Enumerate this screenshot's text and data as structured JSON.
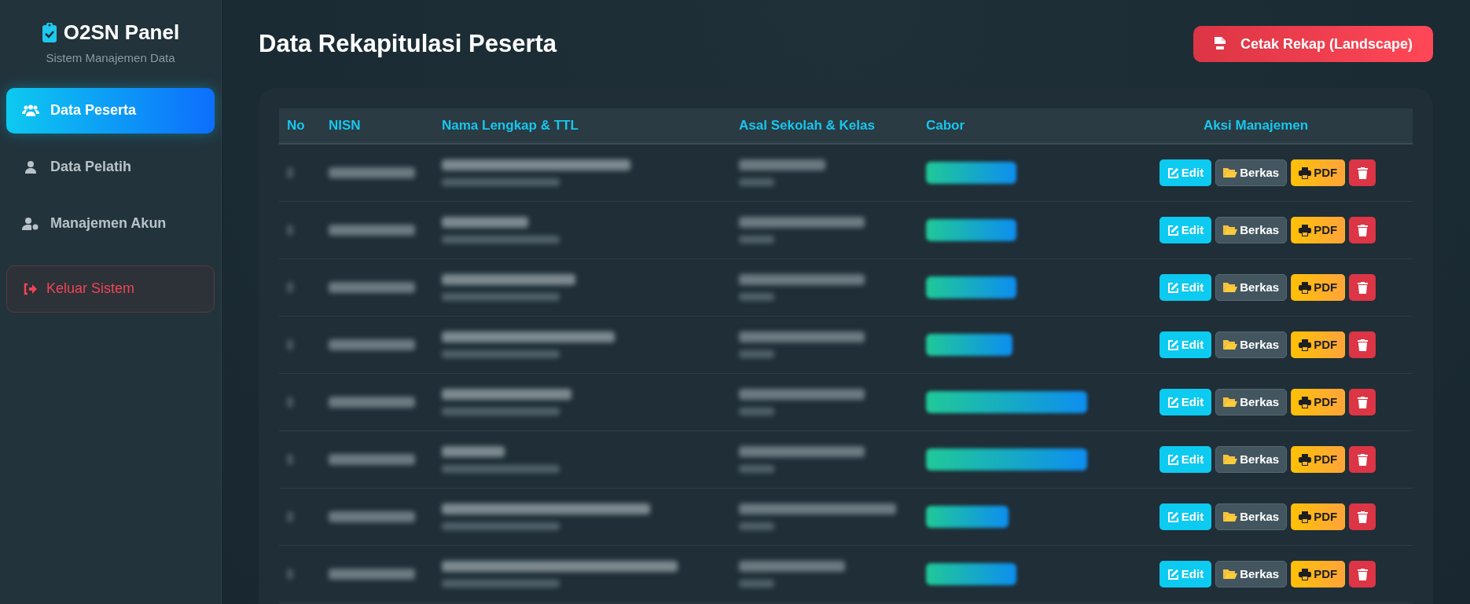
{
  "sidebar": {
    "brand": "O2SN Panel",
    "subtitle": "Sistem Manajemen Data",
    "items": [
      {
        "label": "Data Peserta",
        "selected": true
      },
      {
        "label": "Data Pelatih",
        "selected": false
      },
      {
        "label": "Manajemen Akun",
        "selected": false
      }
    ],
    "logout": "Keluar Sistem"
  },
  "page": {
    "title": "Data Rekapitulasi Peserta",
    "print_button": "Cetak Rekap (Landscape)"
  },
  "table": {
    "columns": [
      "No",
      "NISN",
      "Nama Lengkap & TTL",
      "Asal Sekolah & Kelas",
      "Cabor",
      "Aksi Manajemen"
    ],
    "rows": [
      {
        "actions": [
          "Edit",
          "Berkas",
          "PDF"
        ]
      },
      {
        "actions": [
          "Edit",
          "Berkas",
          "PDF"
        ]
      },
      {
        "actions": [
          "Edit",
          "Berkas",
          "PDF"
        ]
      },
      {
        "actions": [
          "Edit",
          "Berkas",
          "PDF"
        ]
      },
      {
        "actions": [
          "Edit",
          "Berkas",
          "PDF"
        ]
      },
      {
        "actions": [
          "Edit",
          "Berkas",
          "PDF"
        ]
      },
      {
        "actions": [
          "Edit",
          "Berkas",
          "PDF"
        ]
      },
      {
        "actions": [
          "Edit",
          "Berkas",
          "PDF"
        ]
      }
    ]
  }
}
